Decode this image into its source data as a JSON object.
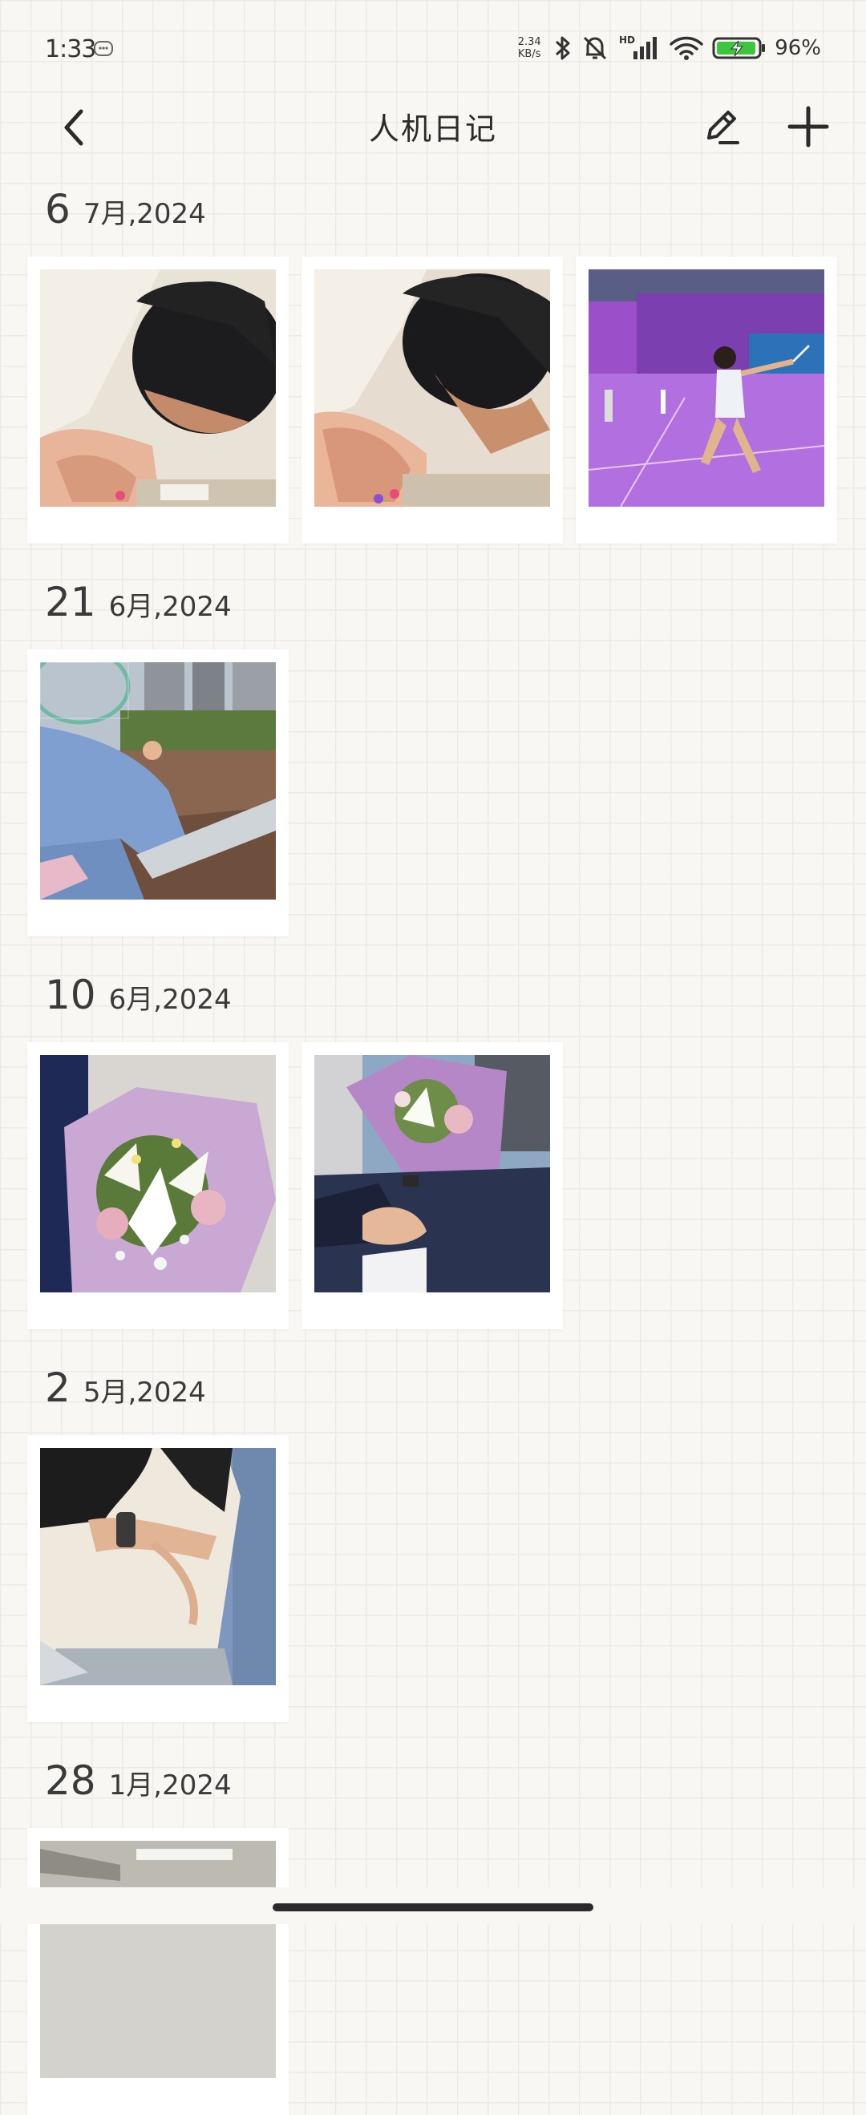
{
  "status_bar": {
    "time": "1:33",
    "net_speed_value": "2.34",
    "net_speed_unit": "KB/s",
    "network_label": "HD",
    "battery_percent": "96%",
    "battery_level": 0.96,
    "accent_battery": "#3ec43e"
  },
  "header": {
    "title": "人机日记",
    "back_icon": "chevron-left-icon",
    "edit_icon": "pencil-icon",
    "add_icon": "plus-icon"
  },
  "sections": [
    {
      "day": "6",
      "month_year": "7月,2024",
      "photos": [
        "person-leaning-over-table-photo",
        "person-leaning-over-table-photo",
        "badminton-player-court-photo"
      ]
    },
    {
      "day": "21",
      "month_year": "6月,2024",
      "photos": [
        "person-holding-racket-city-photo"
      ]
    },
    {
      "day": "10",
      "month_year": "6月,2024",
      "photos": [
        "lily-bouquet-photo",
        "bouquet-holding-hands-photo"
      ]
    },
    {
      "day": "2",
      "month_year": "5月,2024",
      "photos": [
        "hugging-couple-photo"
      ]
    },
    {
      "day": "28",
      "month_year": "1月,2024",
      "photos": [
        "train-interior-photo"
      ]
    }
  ]
}
